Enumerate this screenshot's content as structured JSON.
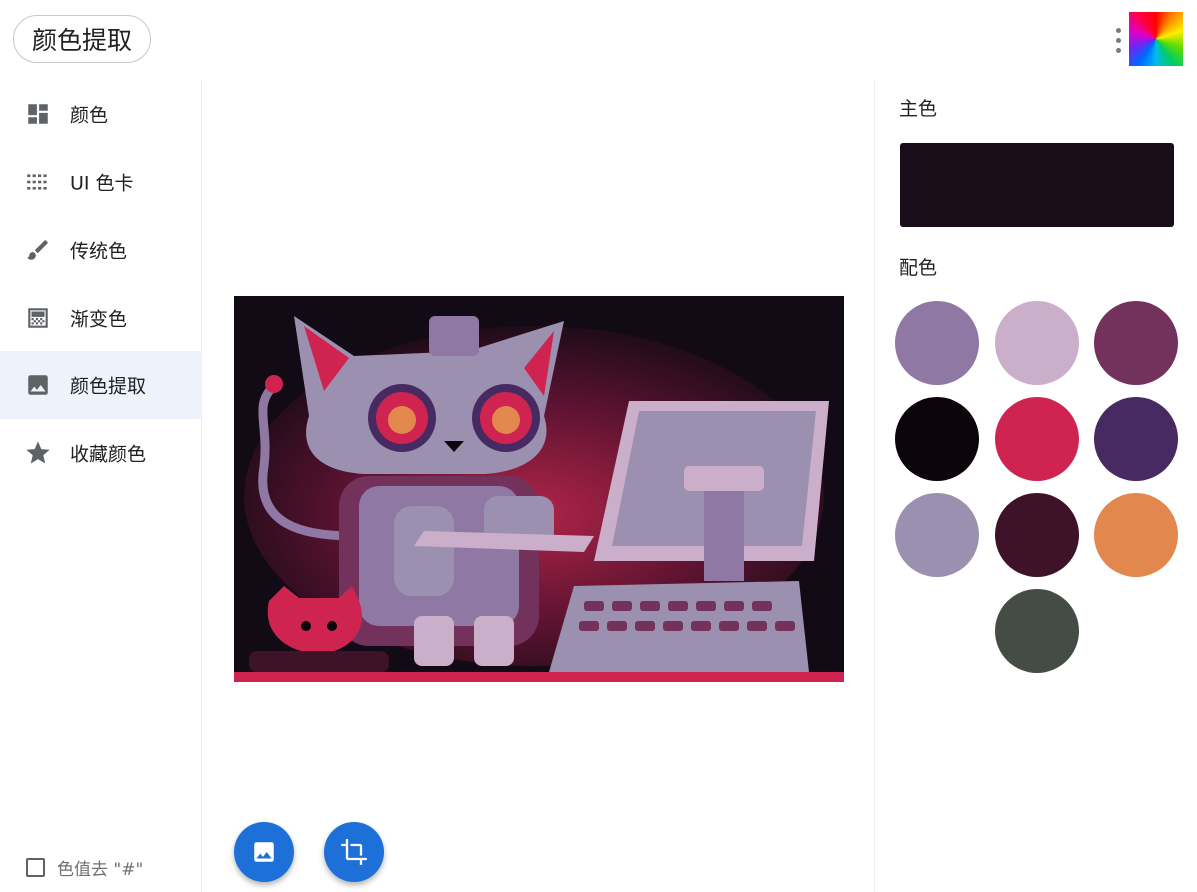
{
  "header": {
    "title": "颜色提取"
  },
  "sidebar": {
    "items": [
      {
        "label": "颜色",
        "icon": "dashboard-icon",
        "active": false
      },
      {
        "label": "UI 色卡",
        "icon": "grid-dots-icon",
        "active": false
      },
      {
        "label": "传统色",
        "icon": "brush-icon",
        "active": false
      },
      {
        "label": "渐变色",
        "icon": "gradient-icon",
        "active": false
      },
      {
        "label": "颜色提取",
        "icon": "image-icon",
        "active": true
      },
      {
        "label": "收藏颜色",
        "icon": "star-icon",
        "active": false
      }
    ],
    "hash_option": {
      "label": "色值去 \"#\"",
      "checked": false
    }
  },
  "main": {
    "image_icon": "robot-cat-illustration",
    "buttons": [
      {
        "name": "pick-image",
        "icon": "image-icon"
      },
      {
        "name": "crop-image",
        "icon": "crop-icon"
      }
    ]
  },
  "palette": {
    "main_heading": "主色",
    "main_color": "#1a0d1a",
    "matching_heading": "配色",
    "colors": [
      "#8f78a4",
      "#cbaeca",
      "#73325c",
      "#0c060c",
      "#d02450",
      "#482a62",
      "#9b90b0",
      "#3e1329",
      "#e2884f",
      "#454c45"
    ]
  },
  "theme": {
    "accent": "#1c70d8",
    "active_bg": "#eef3fb",
    "icon_gray": "#5f6368"
  }
}
